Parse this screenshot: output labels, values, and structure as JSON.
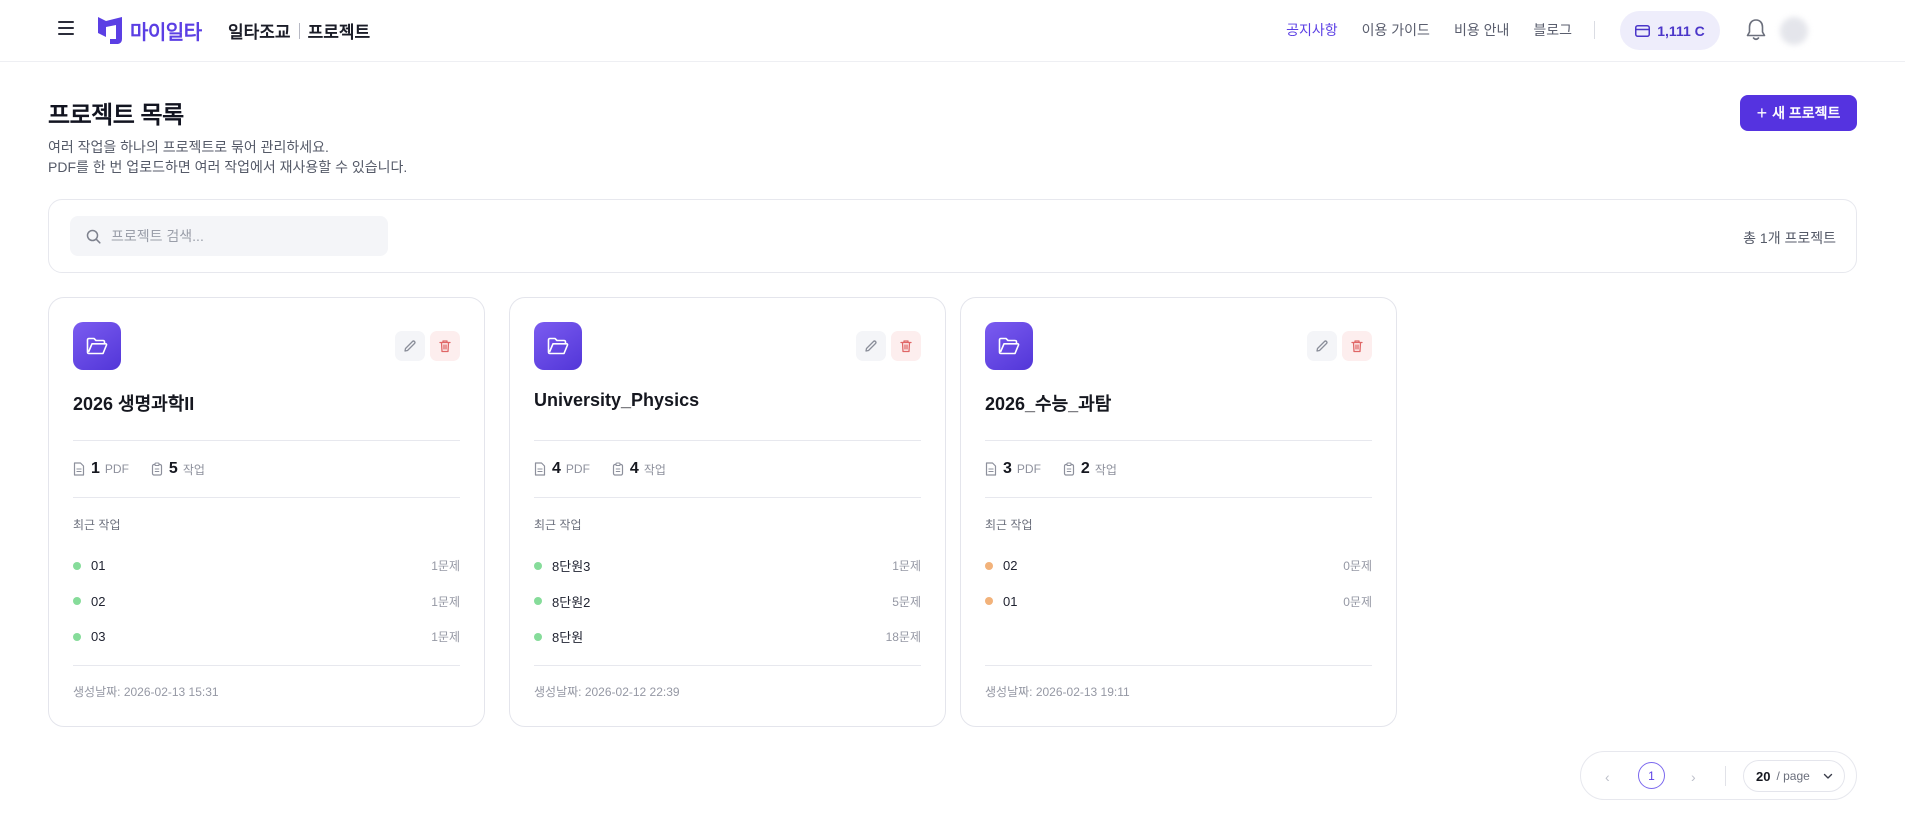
{
  "header": {
    "logo_text": "마이일타",
    "crumb_app": "일타조교",
    "crumb_page": "프로젝트",
    "nav": [
      "공지사항",
      "이용 가이드",
      "비용 안내",
      "블로그"
    ],
    "active_nav": "공지사항",
    "credit": "1,111 C"
  },
  "page": {
    "title": "프로젝트 목록",
    "desc_line1": "여러 작업을 하나의 프로젝트로 묶어 관리하세요.",
    "desc_line2": "PDF를 한 번 업로드하면 여러 작업에서 재사용할 수 있습니다.",
    "new_button": "새 프로젝트",
    "search_placeholder": "프로젝트 검색...",
    "total": "총 1개 프로젝트"
  },
  "labels": {
    "pdf": "PDF",
    "task": "작업",
    "recent": "최근 작업"
  },
  "projects": [
    {
      "title": "2026 생명과학II",
      "pdf_count": "1",
      "task_count": "5",
      "recent": [
        {
          "name": "01",
          "count": "1문제",
          "status": "done"
        },
        {
          "name": "02",
          "count": "1문제",
          "status": "done"
        },
        {
          "name": "03",
          "count": "1문제",
          "status": "done"
        }
      ],
      "created": "생성날짜: 2026-02-13 15:31"
    },
    {
      "title": "University_Physics",
      "pdf_count": "4",
      "task_count": "4",
      "recent": [
        {
          "name": "8단원3",
          "count": "1문제",
          "status": "done"
        },
        {
          "name": "8단원2",
          "count": "5문제",
          "status": "done"
        },
        {
          "name": "8단원",
          "count": "18문제",
          "status": "done"
        }
      ],
      "created": "생성날짜: 2026-02-12 22:39"
    },
    {
      "title": "2026_수능_과탐",
      "pdf_count": "3",
      "task_count": "2",
      "recent": [
        {
          "name": "02",
          "count": "0문제",
          "status": "pending"
        },
        {
          "name": "01",
          "count": "0문제",
          "status": "pending"
        }
      ],
      "created": "생성날짜: 2026-02-13 19:11"
    }
  ],
  "pagination": {
    "current_page": "1",
    "page_size": "20",
    "page_size_suffix": "/ page"
  },
  "colors": {
    "accent": "#5533e0",
    "status_done": "#86dc9a",
    "status_pending": "#f2b27a"
  },
  "icons": {
    "menu": "hamburger-icon",
    "credit": "card-icon",
    "notifications": "bell-icon",
    "search": "search-icon",
    "folder": "folder-open-icon",
    "edit": "pencil-icon",
    "delete": "trash-icon",
    "pdf": "document-icon",
    "task": "clipboard-icon"
  }
}
